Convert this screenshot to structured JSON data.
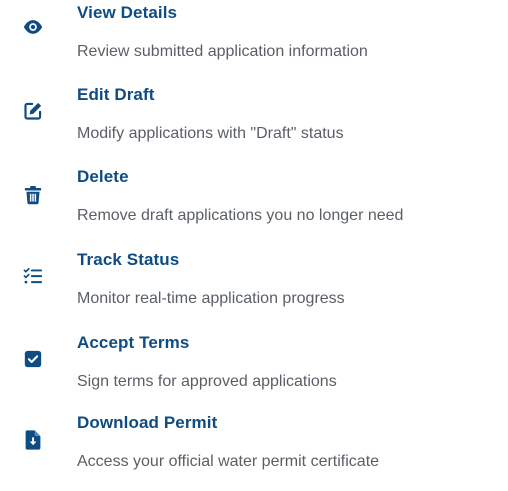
{
  "actions": [
    {
      "title": "View Details",
      "description": "Review submitted application information",
      "icon": "eye-icon"
    },
    {
      "title": "Edit Draft",
      "description": "Modify applications with \"Draft\" status",
      "icon": "edit-icon"
    },
    {
      "title": "Delete",
      "description": "Remove draft applications you no longer need",
      "icon": "trash-icon"
    },
    {
      "title": "Track Status",
      "description": "Monitor real-time application progress",
      "icon": "list-check-icon"
    },
    {
      "title": "Accept Terms",
      "description": "Sign terms for approved applications",
      "icon": "checkbox-icon"
    },
    {
      "title": "Download Permit",
      "description": "Access your official water permit certificate",
      "icon": "file-download-icon"
    }
  ],
  "colors": {
    "accent": "#0f4c81",
    "text_muted": "#5a5f66",
    "background": "#ffffff"
  }
}
